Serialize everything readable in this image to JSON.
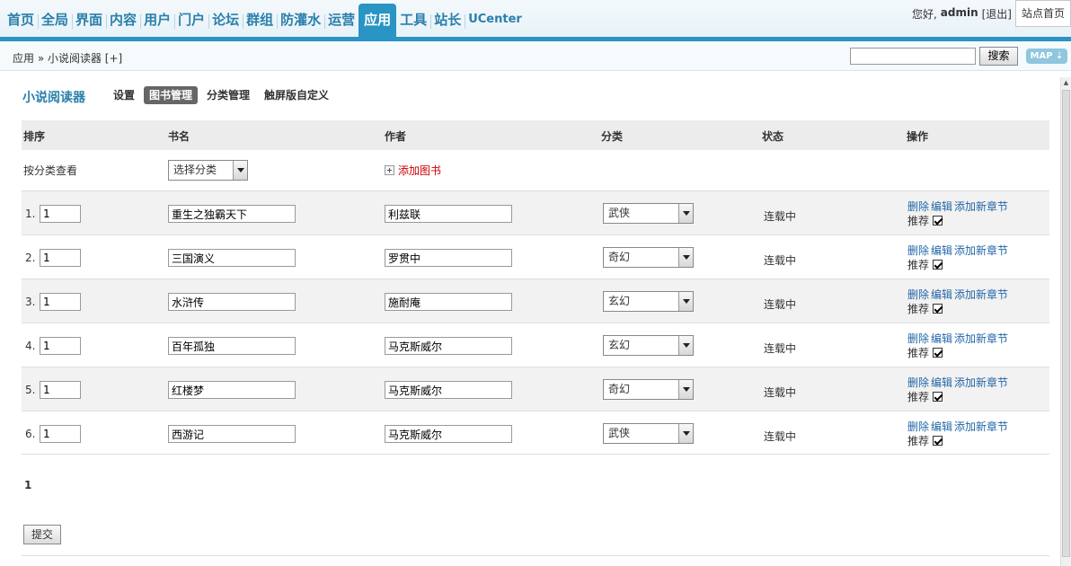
{
  "nav": {
    "items": [
      "首页",
      "全局",
      "界面",
      "内容",
      "用户",
      "门户",
      "论坛",
      "群组",
      "防灌水",
      "运营",
      "应用",
      "工具",
      "站长",
      "UCenter"
    ],
    "active": "应用"
  },
  "user": {
    "greeting": "您好,",
    "name": "admin",
    "logout": "[退出]",
    "home": "站点首页"
  },
  "breadcrumb": "应用 » 小说阅读器 [+]",
  "search": {
    "value": "",
    "button": "搜索"
  },
  "map_button": "MAP ⇣",
  "plugin": {
    "title": "小说阅读器",
    "tabs": [
      "设置",
      "图书管理",
      "分类管理",
      "触屏版自定义"
    ],
    "active_tab": "图书管理"
  },
  "table": {
    "headers": [
      "排序",
      "书名",
      "作者",
      "分类",
      "状态",
      "操作"
    ],
    "filter_label": "按分类查看",
    "filter_select": "选择分类",
    "add_book": "添加图书",
    "rows": [
      {
        "idx": "1.",
        "order": "1",
        "title": "重生之独霸天下",
        "author": "利兹联",
        "category": "武侠",
        "status": "连载中"
      },
      {
        "idx": "2.",
        "order": "1",
        "title": "三国演义",
        "author": "罗贯中",
        "category": "奇幻",
        "status": "连载中"
      },
      {
        "idx": "3.",
        "order": "1",
        "title": "水浒传",
        "author": "施耐庵",
        "category": "玄幻",
        "status": "连载中"
      },
      {
        "idx": "4.",
        "order": "1",
        "title": "百年孤独",
        "author": "马克斯威尔",
        "category": "玄幻",
        "status": "连载中"
      },
      {
        "idx": "5.",
        "order": "1",
        "title": "红楼梦",
        "author": "马克斯威尔",
        "category": "奇幻",
        "status": "连载中"
      },
      {
        "idx": "6.",
        "order": "1",
        "title": "西游记",
        "author": "马克斯威尔",
        "category": "武侠",
        "status": "连载中"
      }
    ],
    "ops": {
      "delete": "删除",
      "edit": "编辑",
      "add_chapter": "添加新章节",
      "recommend": "推荐"
    }
  },
  "pager": "1",
  "submit": "提交"
}
